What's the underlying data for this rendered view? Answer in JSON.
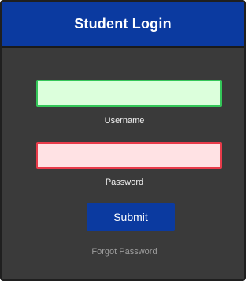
{
  "header": {
    "title": "Student Login"
  },
  "form": {
    "username": {
      "label": "Username",
      "value": "",
      "placeholder": ""
    },
    "password": {
      "label": "Password",
      "value": "",
      "placeholder": ""
    },
    "submit_label": "Submit",
    "forgot_label": "Forgot Password"
  },
  "colors": {
    "header_bg": "#0b3aa0",
    "card_bg": "#3a3a3a",
    "username_fill": "#dcffdc",
    "username_border": "#34c759",
    "password_fill": "#ffe2e4",
    "password_border": "#e83b4a"
  }
}
